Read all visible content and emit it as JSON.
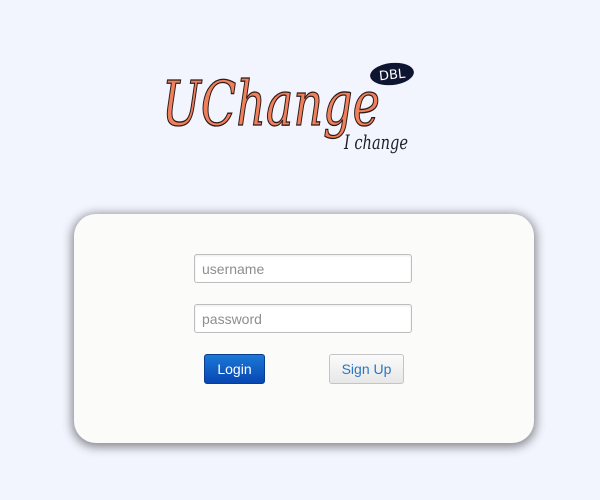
{
  "logo": {
    "brand": "UChange",
    "badge": "DBL",
    "tagline": "I change",
    "colors": {
      "wordmark": "#f07f5b",
      "outline": "#2b1b17",
      "badge": "#0e1530"
    }
  },
  "login": {
    "username_placeholder": "username",
    "password_placeholder": "password",
    "login_label": "Login",
    "signup_label": "Sign Up"
  },
  "colors": {
    "background": "#f2f4fe",
    "card": "#fbfbfa",
    "primary": "#0a5fc7",
    "link": "#2a76c2"
  }
}
